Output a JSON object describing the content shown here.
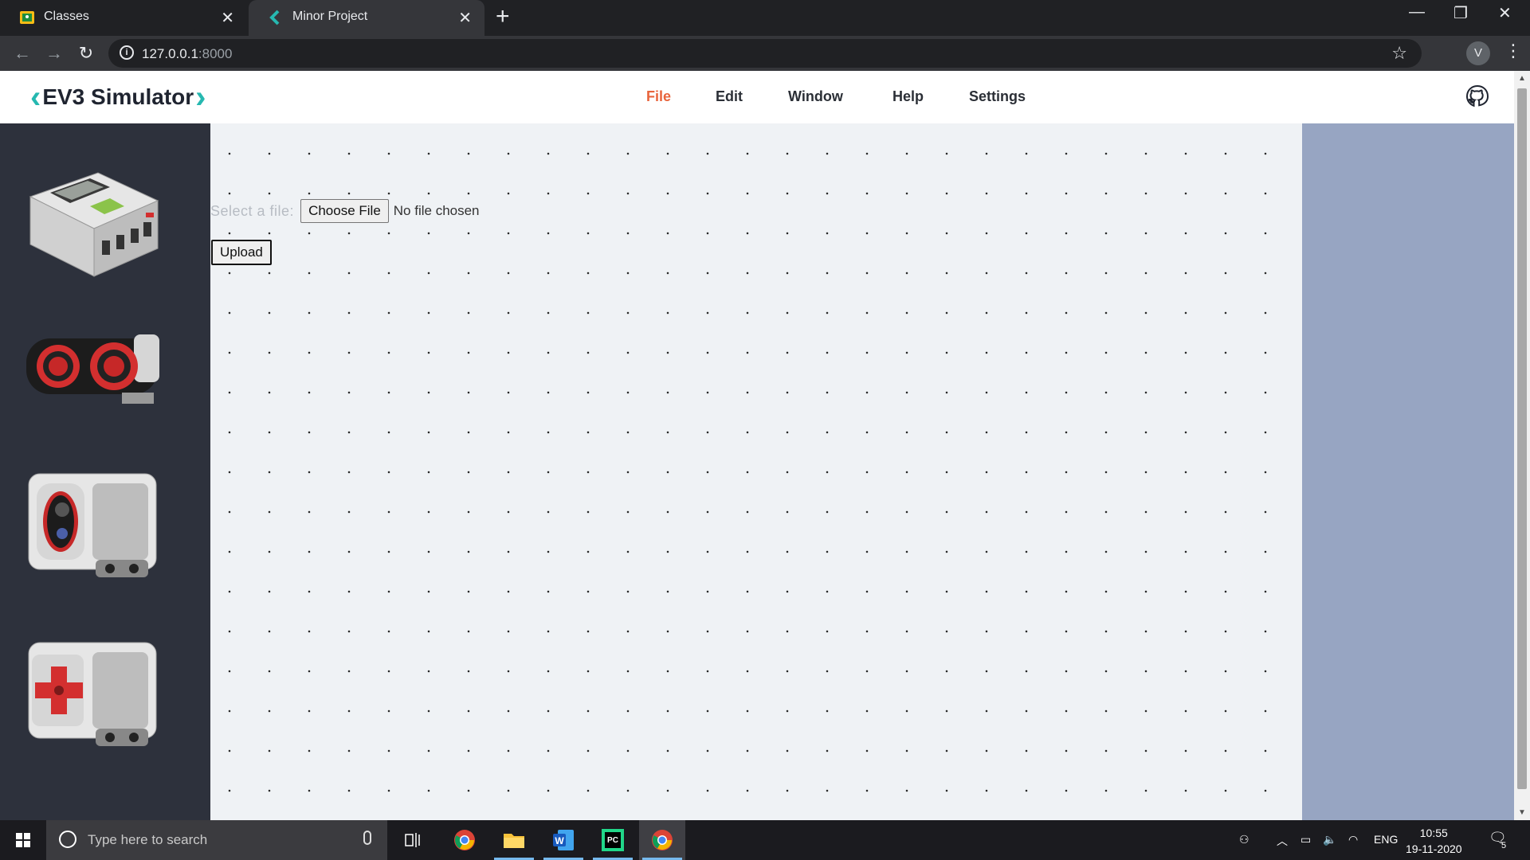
{
  "browser": {
    "tabs": [
      {
        "title": "Classes",
        "active": false,
        "favicon": "classroom-icon"
      },
      {
        "title": "Minor Project",
        "active": true,
        "favicon": "chevron-left-icon"
      }
    ],
    "url_host": "127.0.0.1",
    "url_port": ":8000",
    "profile_initial": "V"
  },
  "app": {
    "logo_text": "EV3 Simulator",
    "menu": [
      {
        "label": "File",
        "active": true
      },
      {
        "label": "Edit",
        "active": false
      },
      {
        "label": "Window",
        "active": false
      },
      {
        "label": "Help",
        "active": false
      },
      {
        "label": "Settings",
        "active": false
      }
    ],
    "sidebar_parts": [
      "ev3-brick-image",
      "ultrasonic-sensor-image",
      "color-sensor-image",
      "touch-sensor-image"
    ],
    "upload": {
      "label": "Select a file:",
      "choose_button": "Choose File",
      "status": "No file chosen",
      "upload_button": "Upload"
    },
    "colors": {
      "accent": "#e8643c",
      "logo": "#26b8b0",
      "sidebar": "#2d313c",
      "canvas": "#eff2f5",
      "right_panel": "#97a5c2"
    }
  },
  "taskbar": {
    "search_placeholder": "Type here to search",
    "language": "ENG",
    "time": "10:55",
    "date": "19-11-2020",
    "notification_count": "5"
  }
}
